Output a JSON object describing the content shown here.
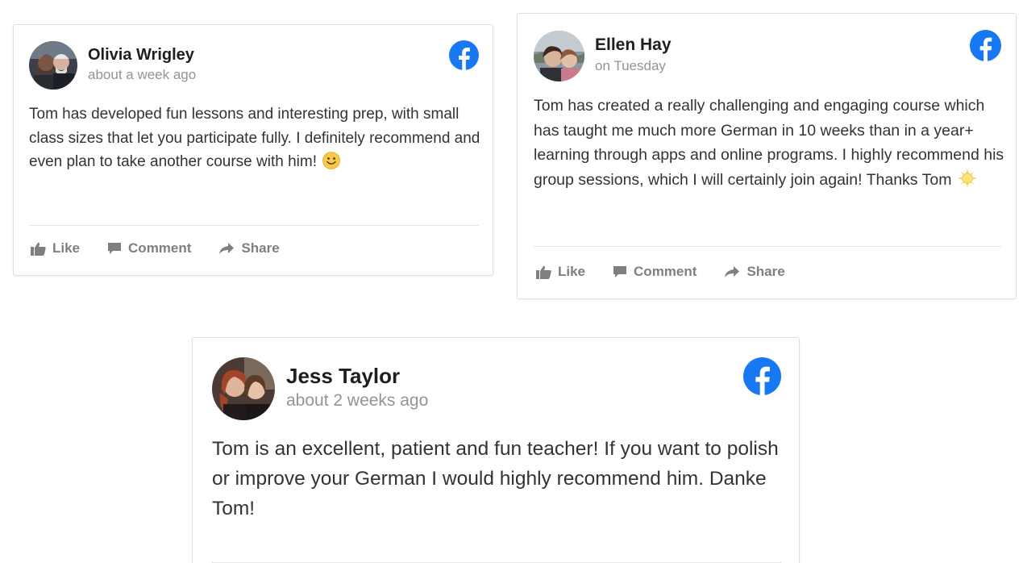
{
  "reviews": [
    {
      "name": "Olivia Wrigley",
      "time": "about a week ago",
      "text": "Tom has developed fun lessons and interesting prep, with small class sizes that let you participate fully. I definitely recommend and even plan to take another course with him!",
      "emoji": "smiley-emoji",
      "actions": {
        "like": "Like",
        "comment": "Comment",
        "share": "Share"
      }
    },
    {
      "name": "Ellen Hay",
      "time": "on Tuesday",
      "text": "Tom has created a really challenging and engaging course which has taught me much more German in 10 weeks than in a year+ learning through apps and online programs. I highly recommend his group sessions, which I will certainly join again! Thanks Tom",
      "emoji": "sun-emoji",
      "actions": {
        "like": "Like",
        "comment": "Comment",
        "share": "Share"
      }
    },
    {
      "name": "Jess Taylor",
      "time": "about 2 weeks ago",
      "text": "Tom is an excellent, patient and fun teacher! If you want to polish or improve your German I would highly recommend him. Danke Tom!"
    }
  ],
  "colors": {
    "facebook_blue": "#1877f2",
    "action_grey": "#7f7f7f",
    "timestamp_grey": "#90949c",
    "border": "#dddfe2"
  },
  "icons": [
    "facebook-logo-icon",
    "thumbs-up-icon",
    "comment-icon",
    "share-arrow-icon"
  ]
}
